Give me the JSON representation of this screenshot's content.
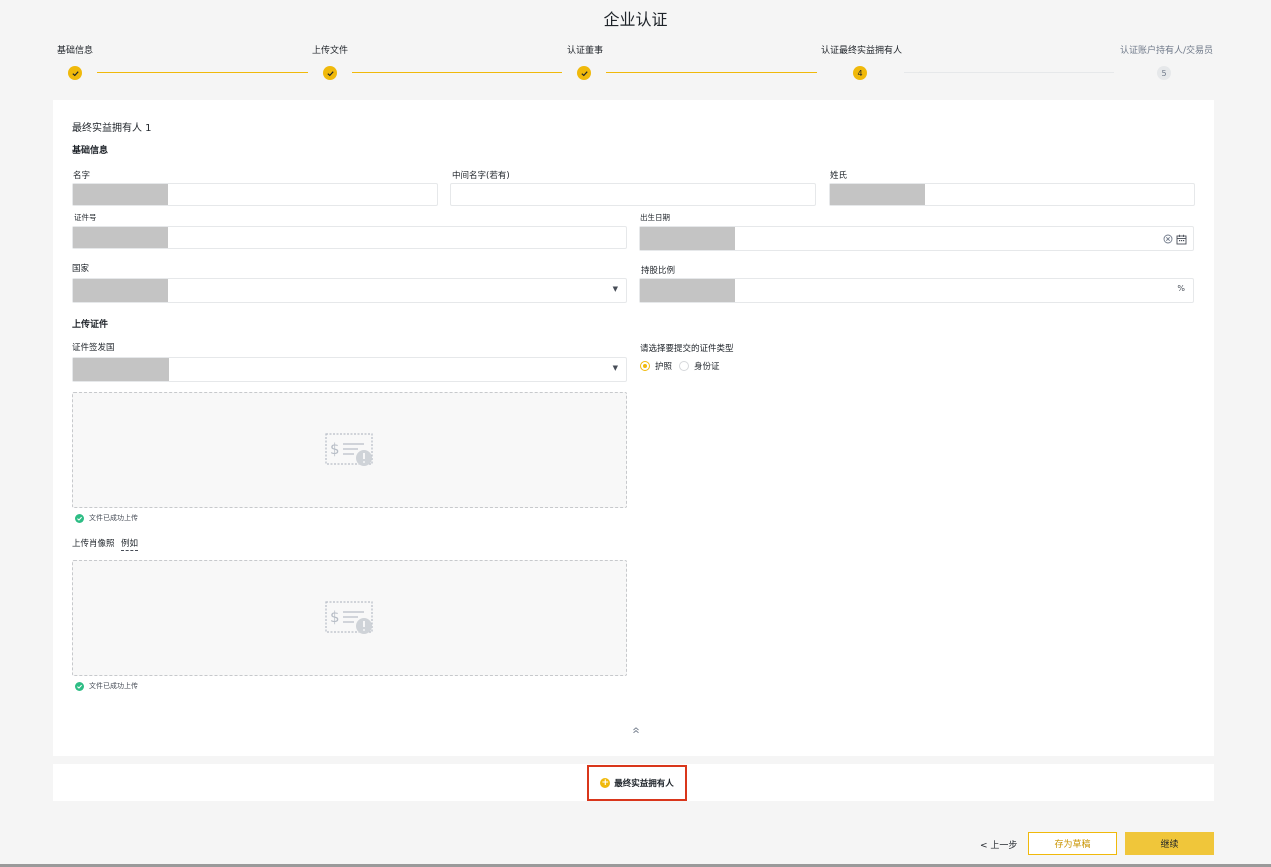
{
  "page_title": "企业认证",
  "steps": [
    {
      "label": "基础信息",
      "status": "done"
    },
    {
      "label": "上传文件",
      "status": "done"
    },
    {
      "label": "认证董事",
      "status": "done"
    },
    {
      "label": "认证最终实益拥有人",
      "status": "current",
      "number": "4"
    },
    {
      "label": "认证账户持有人/交易员",
      "status": "pending",
      "number": "5"
    }
  ],
  "form": {
    "owner_title": "最终实益拥有人 1",
    "section_basic": "基础信息",
    "first_name_label": "名字",
    "middle_name_label": "中间名字(若有)",
    "last_name_label": "姓氏",
    "id_number_label": "证件号",
    "dob_label": "出生日期",
    "country_label": "国家",
    "share_label": "持股比例",
    "share_suffix": "%",
    "section_upload": "上传证件",
    "issuing_country_label": "证件签发国",
    "doc_type_label": "请选择要提交的证件类型",
    "doc_types": [
      "护照",
      "身份证"
    ],
    "doc_type_selected": "护照",
    "upload_success": "文件已成功上传",
    "portrait_label": "上传肖像照",
    "portrait_example": "例如",
    "portrait_success": "文件已成功上传"
  },
  "add_owner_label": "最终实益拥有人",
  "footer": {
    "prev_label": "< 上一步",
    "draft_label": "存为草稿",
    "continue_label": "继续"
  },
  "colors": {
    "accent": "#f0b90b",
    "success": "#2ebd85",
    "highlight_border": "#d9361b"
  }
}
